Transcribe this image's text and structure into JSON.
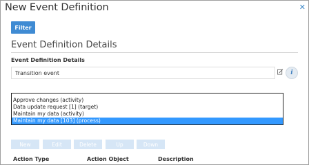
{
  "dialog": {
    "title": "New Event Definition",
    "close_icon": "close-icon"
  },
  "filter_button": {
    "label": "Filter"
  },
  "section": {
    "title": "Event Definition Details",
    "field_label": "Event Definition Details",
    "field_value": "Transition event"
  },
  "icons": {
    "edit": "edit-icon",
    "info": "info-icon"
  },
  "listbox": {
    "items": [
      "Approve changes (activity)",
      "Data update request [1] (target)",
      "Maintain my data (activity)",
      "Maintain my data [103] (process)"
    ],
    "selected_index": 3
  },
  "toolbar": {
    "new": "New",
    "edit": "Edit",
    "delete": "Delete",
    "up": "Up",
    "down": "Down"
  },
  "table": {
    "columns": [
      "Action Type",
      "Action Object",
      "Description"
    ]
  },
  "colors": {
    "accent": "#3f8bd3",
    "selection": "#3399ff",
    "disabled_button": "#d6e6f6"
  }
}
